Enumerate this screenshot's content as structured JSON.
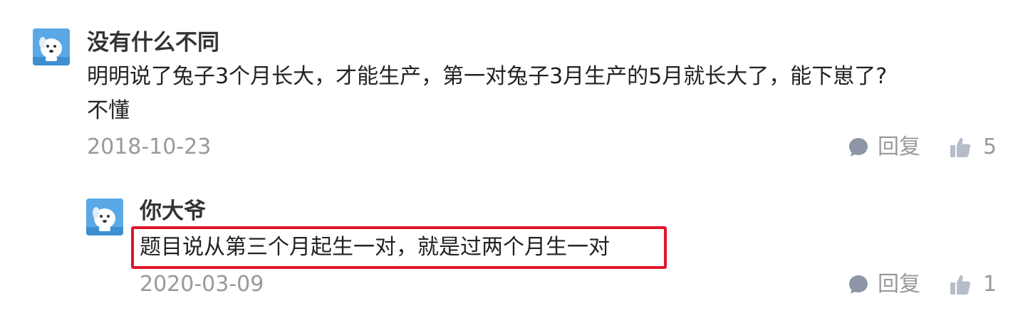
{
  "comments": [
    {
      "username": "没有什么不同",
      "content_line1": "明明说了兔子3个月长大，才能生产，第一对兔子3月生产的5月就长大了，能下崽了?",
      "content_line2": "不懂",
      "date": "2018-10-23",
      "reply_label": "回复",
      "like_count": "5",
      "reply": {
        "username": "你大爷",
        "content": "题目说从第三个月起生一对，就是过两个月生一对",
        "date": "2020-03-09",
        "reply_label": "回复",
        "like_count": "1"
      }
    }
  ],
  "icons": {
    "reply": "speech-bubble-icon",
    "like": "thumbs-up-icon",
    "avatar": "cartoon-dog-avatar"
  },
  "colors": {
    "highlight_border": "#e0162b",
    "icon_gray": "#b6bcc9",
    "reply_icon": "#8d96a6",
    "avatar_bg": "#5aa9e6"
  }
}
